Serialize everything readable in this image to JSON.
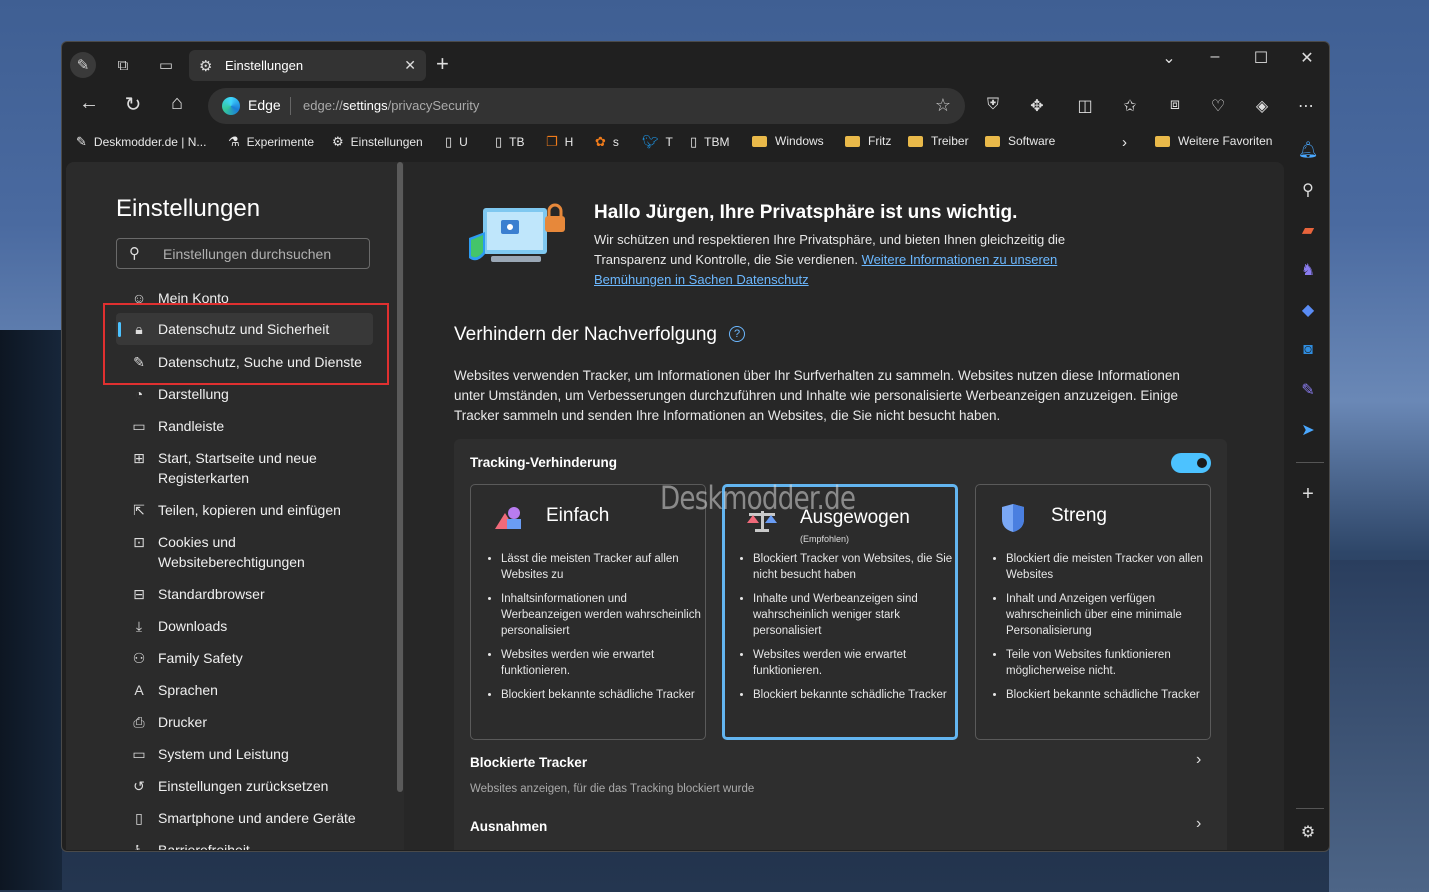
{
  "tab": {
    "title": "Einstellungen"
  },
  "omnibox": {
    "brand": "Edge",
    "url_prefix": "edge://",
    "url_host": "settings",
    "url_path": "/privacySecurity"
  },
  "bookmarks": [
    {
      "label": "Deskmodder.de | N...",
      "icon": "pen-icon"
    },
    {
      "label": "Experimente",
      "icon": "flask-icon"
    },
    {
      "label": "Einstellungen",
      "icon": "gear-icon"
    },
    {
      "label": "U",
      "icon": "page-icon"
    },
    {
      "label": "TB",
      "icon": "page-icon"
    },
    {
      "label": "H",
      "icon": "windows-icon"
    },
    {
      "label": "s",
      "icon": "app-icon"
    },
    {
      "label": "T",
      "icon": "twitter-icon"
    },
    {
      "label": "TBM",
      "icon": "page-icon"
    },
    {
      "label": "Windows",
      "icon": "folder-icon"
    },
    {
      "label": "Fritz",
      "icon": "folder-icon"
    },
    {
      "label": "Treiber",
      "icon": "folder-icon"
    },
    {
      "label": "Software",
      "icon": "folder-icon"
    },
    {
      "label": "Weitere Favoriten",
      "icon": "folder-icon"
    }
  ],
  "sidebar": {
    "title": "Einstellungen",
    "search_placeholder": "Einstellungen durchsuchen",
    "items": [
      {
        "label": "Mein Konto"
      },
      {
        "label": "Datenschutz und Sicherheit"
      },
      {
        "label": "Datenschutz, Suche und Dienste"
      },
      {
        "label": "Darstellung"
      },
      {
        "label": "Randleiste"
      },
      {
        "label": "Start, Startseite und neue Registerkarten"
      },
      {
        "label": "Teilen, kopieren und einfügen"
      },
      {
        "label": "Cookies und Websiteberechtigungen"
      },
      {
        "label": "Standardbrowser"
      },
      {
        "label": "Downloads"
      },
      {
        "label": "Family Safety"
      },
      {
        "label": "Sprachen"
      },
      {
        "label": "Drucker"
      },
      {
        "label": "System und Leistung"
      },
      {
        "label": "Einstellungen zurücksetzen"
      },
      {
        "label": "Smartphone und andere Geräte"
      },
      {
        "label": "Barrierefreiheit"
      }
    ]
  },
  "hero": {
    "title": "Hallo Jürgen, Ihre Privatsphäre ist uns wichtig.",
    "text": "Wir schützen und respektieren Ihre Privatsphäre, und bieten Ihnen gleichzeitig die Transparenz und Kontrolle, die Sie verdienen.",
    "link": "Weitere Informationen zu unseren Bemühungen in Sachen Datenschutz"
  },
  "tracking": {
    "section_title": "Verhindern der Nachverfolgung",
    "help": "?",
    "description": "Websites verwenden Tracker, um Informationen über Ihr Surfverhalten zu sammeln. Websites nutzen diese Informationen unter Umständen, um Verbesserungen durchzuführen und Inhalte wie personalisierte Werbeanzeigen anzuzeigen. Einige Tracker sammeln und senden Ihre Informationen an Websites, die Sie nicht besucht haben.",
    "card_title": "Tracking-Verhinderung",
    "enabled": true,
    "options": [
      {
        "name": "Einfach",
        "sub": "",
        "selected": false,
        "bullets": [
          "Lässt die meisten Tracker auf allen Websites zu",
          "Inhaltsinformationen und Werbeanzeigen werden wahrscheinlich personalisiert",
          "Websites werden wie erwartet funktionieren.",
          "Blockiert bekannte schädliche Tracker"
        ]
      },
      {
        "name": "Ausgewogen",
        "sub": "(Empfohlen)",
        "selected": true,
        "bullets": [
          "Blockiert Tracker von Websites, die Sie nicht besucht haben",
          "Inhalte und Werbeanzeigen sind wahrscheinlich weniger stark personalisiert",
          "Websites werden wie erwartet funktionieren.",
          "Blockiert bekannte schädliche Tracker"
        ]
      },
      {
        "name": "Streng",
        "sub": "",
        "selected": false,
        "bullets": [
          "Blockiert die meisten Tracker von allen Websites",
          "Inhalt und Anzeigen verfügen wahrscheinlich über eine minimale Personalisierung",
          "Teile von Websites funktionieren möglicherweise nicht.",
          "Blockiert bekannte schädliche Tracker"
        ]
      }
    ],
    "watermark": "Deskmodder.de",
    "blocked_title": "Blockierte Tracker",
    "blocked_sub": "Websites anzeigen, für die das Tracking blockiert wurde",
    "exceptions_title": "Ausnahmen"
  },
  "colors": {
    "accent": "#4cc2ff",
    "highlight_box": "#e03030",
    "link": "#6cb8ff"
  }
}
